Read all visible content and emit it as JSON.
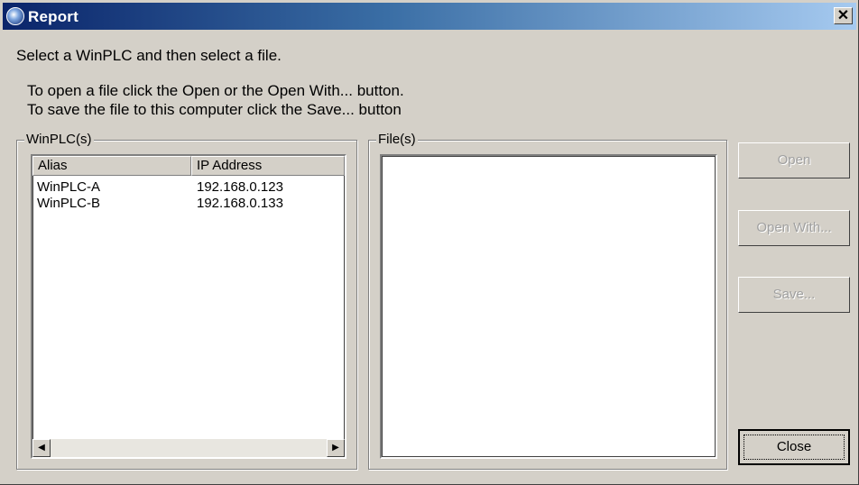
{
  "window": {
    "title": "Report",
    "close_glyph": "✕"
  },
  "instructions": {
    "line1": "Select a WinPLC and then select a file.",
    "line2": "To open a file click the Open or the Open With... button.",
    "line3": "To save the file to this computer click the Save... button"
  },
  "winplcs": {
    "group_label": "WinPLC(s)",
    "columns": [
      "Alias",
      "IP Address"
    ],
    "rows": [
      {
        "alias": "WinPLC-A",
        "ip": "192.168.0.123"
      },
      {
        "alias": "WinPLC-B",
        "ip": "192.168.0.133"
      }
    ],
    "scroll_left_glyph": "◀",
    "scroll_right_glyph": "▶"
  },
  "files": {
    "group_label": "File(s)",
    "items": []
  },
  "buttons": {
    "open": {
      "label": "Open",
      "enabled": false
    },
    "open_with": {
      "label": "Open With...",
      "enabled": false
    },
    "save": {
      "label": "Save...",
      "enabled": false
    },
    "close": {
      "label": "Close",
      "enabled": true
    }
  },
  "icons": {
    "app": "report-app-icon",
    "close": "close-icon"
  }
}
